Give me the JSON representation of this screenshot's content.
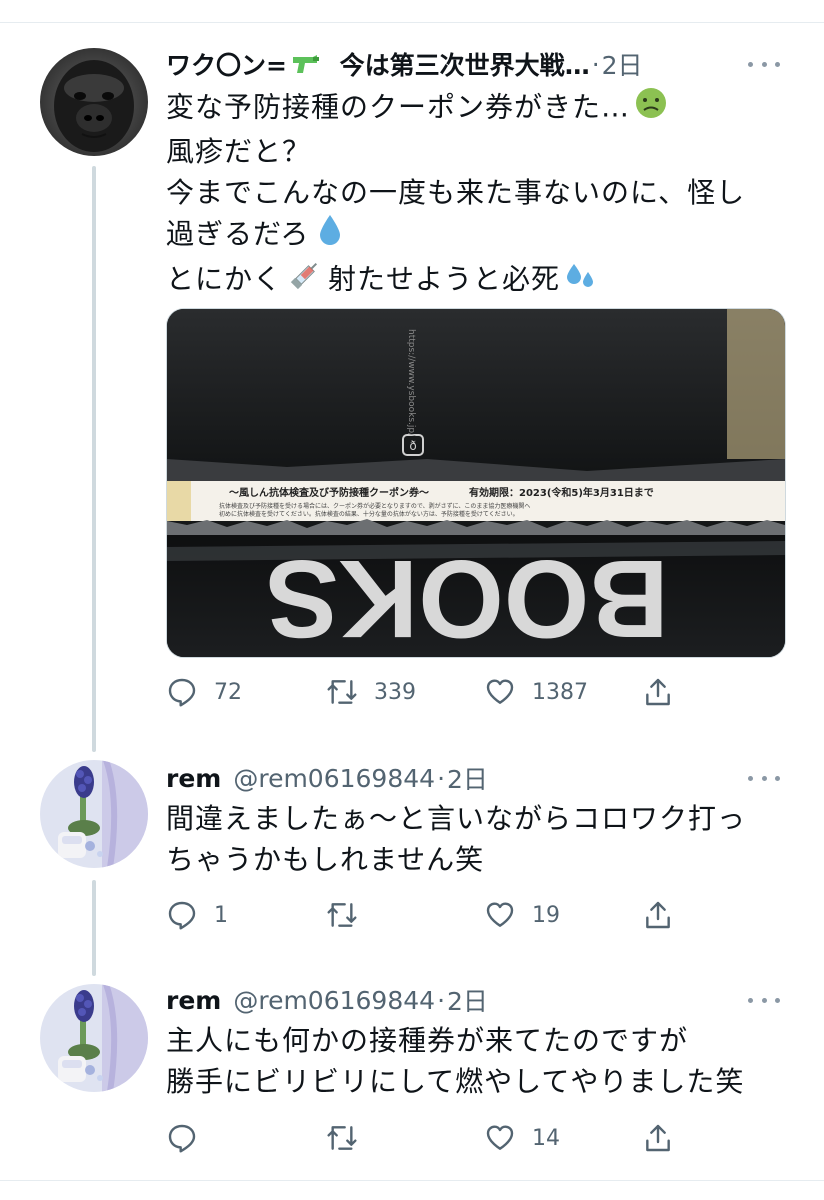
{
  "tweets": [
    {
      "name_prefix": "ワク〇ン=",
      "name_icon": "water-pistol-icon",
      "name_suffix": "今は第三次世界大戦",
      "name_ellipsis": "…",
      "separator": "·",
      "time": "2日",
      "text_lines": [
        "変な予防接種のクーポン券がきた…",
        "風疹だと？",
        "今までこんなの一度も来た事ないのに、怪し",
        "過ぎるだろ",
        "とにかく",
        "射たせようと必死"
      ],
      "emojis": [
        "nauseated-face-icon",
        "droplet-icon",
        "syringe-icon",
        "sweat-droplets-icon"
      ],
      "media": {
        "coupon_title": "〜風しん抗体検査及び予防接種クーポン券〜",
        "coupon_expiry": "有効期限：2023(令和5)年3月31日まで",
        "coupon_small_1": "抗体検査及び予防接種を受ける場合には、クーポン券が必要となりますので、剥がさずに、このまま協力医療機関へ",
        "coupon_small_2": "初めに抗体検査を受けてください。抗体検査の結果、十分な量の抗体がない方は、予防接種を受けてください。",
        "bag_text": "BOOKS",
        "side_text": "https://www.ysbooks.jp/"
      },
      "replies": "72",
      "retweets": "339",
      "likes": "1387"
    },
    {
      "name": "rem",
      "handle": "@rem06169844",
      "separator": "·",
      "time": "2日",
      "text_lines": [
        "間違えましたぁ〜と言いながらコロワク打っ",
        "ちゃうかもしれません笑"
      ],
      "replies": "1",
      "retweets": "",
      "likes": "19"
    },
    {
      "name": "rem",
      "handle": "@rem06169844",
      "separator": "·",
      "time": "2日",
      "text_lines": [
        "主人にも何かの接種券が来てたのですが",
        "勝手にビリビリにして燃やしてやりました笑"
      ],
      "replies": "",
      "retweets": "",
      "likes": "14"
    }
  ],
  "colors": {
    "text": "#0f1419",
    "secondary": "#536471",
    "thread_line": "#cfd9de",
    "divider": "#e6ecf0"
  }
}
